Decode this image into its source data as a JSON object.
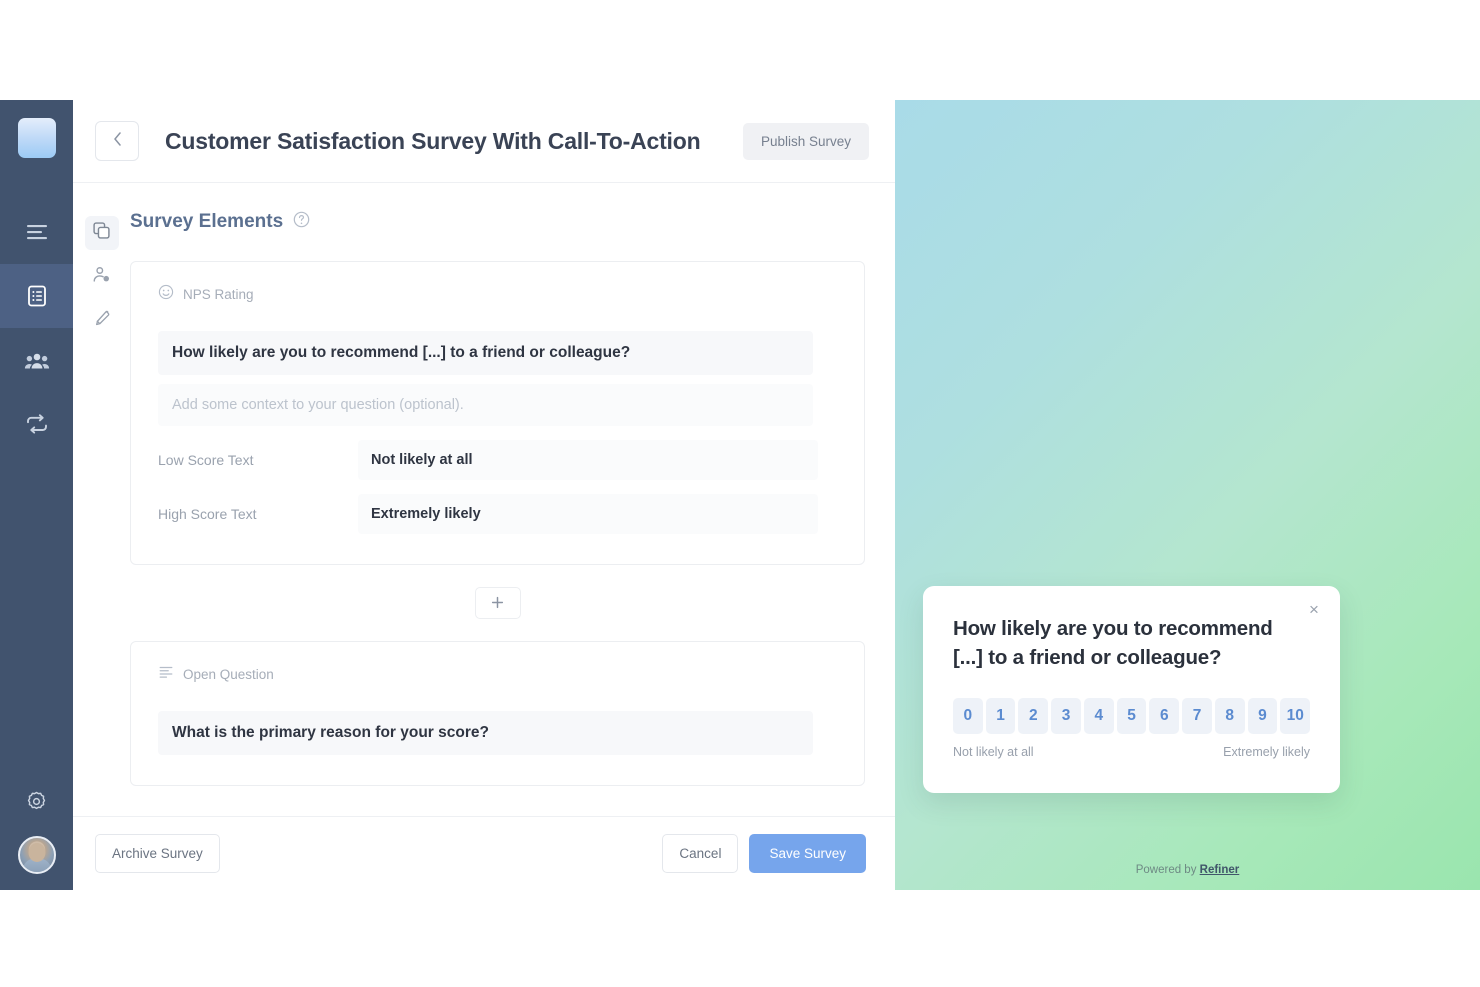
{
  "header": {
    "back_icon": "chevron-left-icon",
    "title": "Customer Satisfaction Survey With Call-To-Action",
    "publish_label": "Publish Survey"
  },
  "rail": {
    "logo_name": "app-logo",
    "items": [
      {
        "icon": "menu-list-icon",
        "name": "nav-menu",
        "active": false
      },
      {
        "icon": "survey-form-icon",
        "name": "nav-surveys",
        "active": true
      },
      {
        "icon": "people-group-icon",
        "name": "nav-audience",
        "active": false
      },
      {
        "icon": "loop-repeat-icon",
        "name": "nav-integrations",
        "active": false
      }
    ],
    "settings_icon": "gear-icon",
    "avatar_name": "user-avatar"
  },
  "icon_column": [
    {
      "icon": "layers-icon",
      "name": "tab-elements",
      "active": true
    },
    {
      "icon": "person-settings-icon",
      "name": "tab-targeting",
      "active": false
    },
    {
      "icon": "paintbrush-icon",
      "name": "tab-design",
      "active": false
    }
  ],
  "section": {
    "title": "Survey Elements",
    "help_icon": "help-circle-icon"
  },
  "elements": [
    {
      "kind_icon": "smiley-icon",
      "kind_label": "NPS Rating",
      "question": "How likely are you to recommend [...] to a friend or colleague?",
      "context_placeholder": "Add some context to your question (optional).",
      "fields": [
        {
          "label": "Low Score Text",
          "value": "Not likely at all"
        },
        {
          "label": "High Score Text",
          "value": "Extremely likely"
        }
      ]
    },
    {
      "kind_icon": "text-lines-icon",
      "kind_label": "Open Question",
      "question": "What is the primary reason for your score?",
      "context_placeholder": "",
      "fields": []
    }
  ],
  "add_button": {
    "icon": "plus-icon",
    "label": "+"
  },
  "footer": {
    "archive_label": "Archive Survey",
    "cancel_label": "Cancel",
    "save_label": "Save Survey"
  },
  "preview": {
    "close_icon": "close-icon",
    "close_label": "×",
    "question": "How likely are you to recommend [...] to a friend or colleague?",
    "scale": [
      "0",
      "1",
      "2",
      "3",
      "4",
      "5",
      "6",
      "7",
      "8",
      "9",
      "10"
    ],
    "low_label": "Not likely at all",
    "high_label": "Extremely likely",
    "powered_prefix": "Powered by ",
    "powered_brand": "Refiner"
  },
  "colors": {
    "rail_bg": "#41536e",
    "rail_active": "#4d6184",
    "accent_blue": "#76a5ec",
    "section_title": "#5b7090",
    "chip_text": "#5b8bd0",
    "chip_bg": "#eef2f8",
    "gradient_from": "#a9dbe8",
    "gradient_to": "#9ae5ae"
  }
}
